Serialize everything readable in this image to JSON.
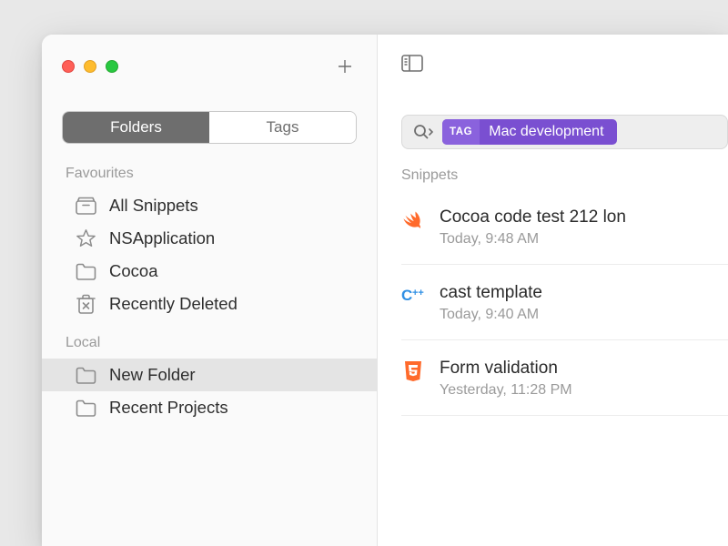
{
  "sidebar": {
    "segmented": {
      "folders": "Folders",
      "tags": "Tags"
    },
    "sections": {
      "favourites": {
        "label": "Favourites",
        "items": [
          {
            "label": "All Snippets"
          },
          {
            "label": "NSApplication"
          },
          {
            "label": "Cocoa"
          },
          {
            "label": "Recently Deleted"
          }
        ]
      },
      "local": {
        "label": "Local",
        "items": [
          {
            "label": "New Folder"
          },
          {
            "label": "Recent Projects"
          }
        ]
      }
    }
  },
  "content": {
    "search": {
      "tag_badge": "TAG",
      "tag_value": "Mac development"
    },
    "snippets_label": "Snippets",
    "snippets": [
      {
        "title": "Cocoa code test 212 lon",
        "date": "Today, 9:48 AM"
      },
      {
        "title": "cast template",
        "date": "Today, 9:40 AM"
      },
      {
        "title": "Form validation",
        "date": "Yesterday, 11:28 PM"
      }
    ]
  }
}
